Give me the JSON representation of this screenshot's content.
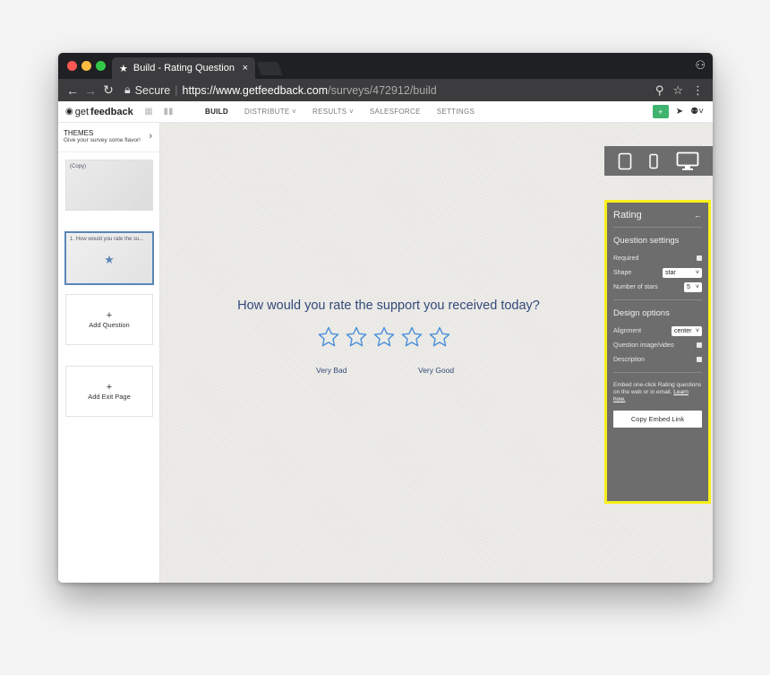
{
  "browser": {
    "tab_title": "Build - Rating Question Type",
    "tab_close": "×",
    "secure_label": "Secure",
    "url_host": "https://www.getfeedback.com",
    "url_path": "/surveys/472912/build"
  },
  "app": {
    "logo_prefix": "get",
    "logo_bold": "feedback",
    "nav": {
      "build": "BUILD",
      "distribute": "DISTRIBUTE ˅",
      "results": "RESULTS ˅",
      "salesforce": "SALESFORCE",
      "settings": "SETTINGS"
    }
  },
  "sidebar": {
    "themes_title": "THEMES",
    "themes_subtitle": "Give your survey some flavor!",
    "thumb_copy_label": "(Copy)",
    "thumb_question_label": "1. How would you rate the su...",
    "add_question_plus": "+",
    "add_question_label": "Add Question",
    "add_exit_plus": "+",
    "add_exit_label": "Add Exit Page"
  },
  "canvas": {
    "question": "How would you rate the support you received today?",
    "star_count": 5,
    "scale_low": "Very Bad",
    "scale_high": "Very Good",
    "star_color": "#4a90d9"
  },
  "panel": {
    "title": "Rating",
    "back_icon": "←",
    "question_settings_title": "Question settings",
    "required_label": "Required",
    "shape_label": "Shape",
    "shape_value": "star",
    "stars_label": "Number of stars",
    "stars_value": "5",
    "design_title": "Design options",
    "alignment_label": "Alignment",
    "alignment_value": "center",
    "media_label": "Question image/video",
    "description_label": "Description",
    "embed_text": "Embed one-click Rating questions on the web or in email.",
    "embed_link": "Learn how.",
    "embed_button": "Copy Embed Link",
    "highlight_color": "#f7ef1a"
  }
}
